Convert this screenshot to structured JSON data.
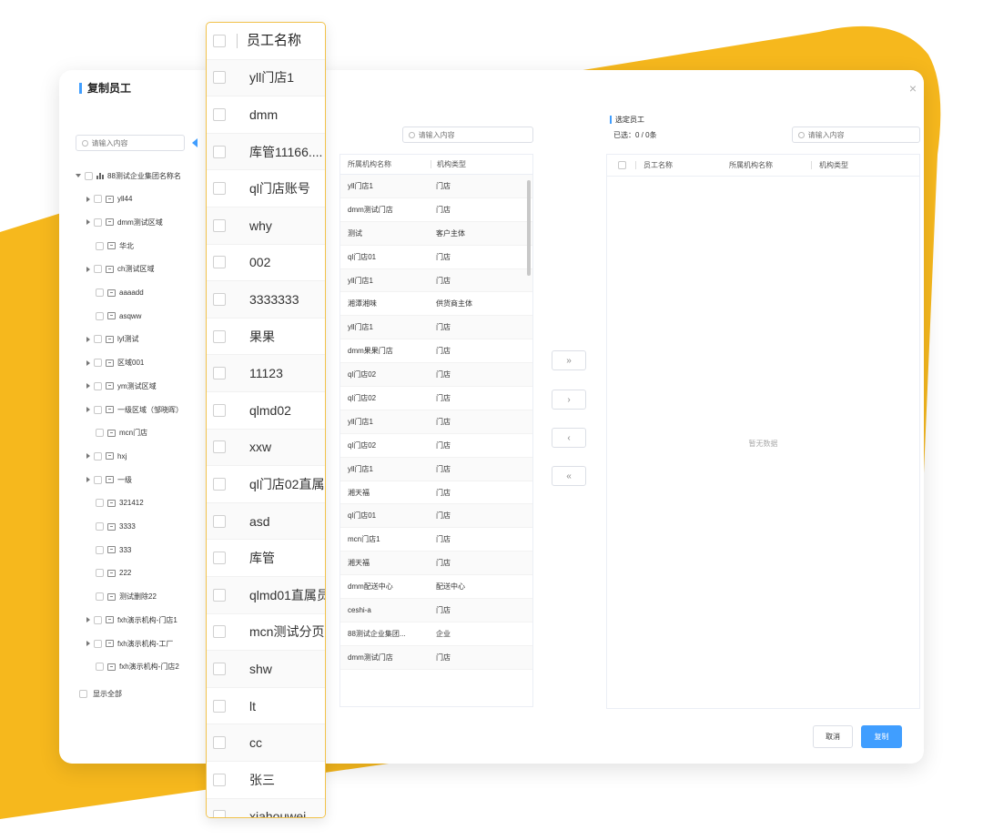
{
  "colors": {
    "accent": "#409eff",
    "yellow": "#f6b81d"
  },
  "dialog": {
    "title": "复制员工",
    "close_icon": "×",
    "left": {
      "search_placeholder": "请输入内容",
      "tree": [
        {
          "label": "88测试企业集团名称名",
          "depth": 0,
          "caret": "down",
          "icon": "bars"
        },
        {
          "label": "yll44",
          "depth": 1,
          "caret": "right"
        },
        {
          "label": "dmm测试区域",
          "depth": 1,
          "caret": "right"
        },
        {
          "label": "华北",
          "depth": 1,
          "caret": "none"
        },
        {
          "label": "ch测试区域",
          "depth": 1,
          "caret": "right"
        },
        {
          "label": "aaaadd",
          "depth": 1,
          "caret": "none"
        },
        {
          "label": "asqww",
          "depth": 1,
          "caret": "none"
        },
        {
          "label": "lyl测试",
          "depth": 1,
          "caret": "right"
        },
        {
          "label": "区域001",
          "depth": 1,
          "caret": "right"
        },
        {
          "label": "ym测试区域",
          "depth": 1,
          "caret": "right"
        },
        {
          "label": "一级区域（邹晓晖）",
          "depth": 1,
          "caret": "right"
        },
        {
          "label": "mcn门店",
          "depth": 1,
          "caret": "none"
        },
        {
          "label": "hxj",
          "depth": 1,
          "caret": "right"
        },
        {
          "label": "一级",
          "depth": 1,
          "caret": "right"
        },
        {
          "label": "321412",
          "depth": 1,
          "caret": "none"
        },
        {
          "label": "3333",
          "depth": 1,
          "caret": "none"
        },
        {
          "label": "333",
          "depth": 1,
          "caret": "none"
        },
        {
          "label": "222",
          "depth": 1,
          "caret": "none"
        },
        {
          "label": "测试删除22",
          "depth": 1,
          "caret": "none"
        },
        {
          "label": "fxh演示机构-门店1",
          "depth": 1,
          "caret": "right"
        },
        {
          "label": "fxh演示机构-工厂",
          "depth": 1,
          "caret": "right"
        },
        {
          "label": "fxh演示机构-门店2",
          "depth": 1,
          "caret": "none"
        }
      ],
      "show_all": "显示全部"
    },
    "middle": {
      "search_placeholder": "请输入内容",
      "columns": [
        "所属机构名称",
        "机构类型"
      ],
      "rows": [
        [
          "yll门店1",
          "门店"
        ],
        [
          "dmm测试门店",
          "门店"
        ],
        [
          "测试",
          "客户主体"
        ],
        [
          "ql门店01",
          "门店"
        ],
        [
          "yll门店1",
          "门店"
        ],
        [
          "湘潭湘味",
          "供货商主体"
        ],
        [
          "yll门店1",
          "门店"
        ],
        [
          "dmm果果门店",
          "门店"
        ],
        [
          "ql门店02",
          "门店"
        ],
        [
          "ql门店02",
          "门店"
        ],
        [
          "yll门店1",
          "门店"
        ],
        [
          "ql门店02",
          "门店"
        ],
        [
          "yll门店1",
          "门店"
        ],
        [
          "湘天福",
          "门店"
        ],
        [
          "ql门店01",
          "门店"
        ],
        [
          "mcn门店1",
          "门店"
        ],
        [
          "湘天福",
          "门店"
        ],
        [
          "dmm配送中心",
          "配送中心"
        ],
        [
          "ceshi-a",
          "门店"
        ],
        [
          "88测试企业集团...",
          "企业"
        ],
        [
          "dmm测试门店",
          "门店"
        ]
      ]
    },
    "transfer": {
      "all_right": "»",
      "right": "›",
      "left": "‹",
      "all_left": "«"
    },
    "right": {
      "title": "选定员工",
      "count": "已选：0 / 0条",
      "search_placeholder": "请输入内容",
      "columns": [
        "员工名称",
        "所属机构名称",
        "机构类型"
      ],
      "empty": "暂无数据"
    },
    "footer": {
      "cancel": "取消",
      "copy": "复制"
    }
  },
  "zoom": {
    "header": "员工名称",
    "names": [
      "yll门店1",
      "dmm",
      "库管11166....",
      "ql门店账号",
      "why",
      "002",
      "3333333",
      "果果",
      "11123",
      "qlmd02",
      "xxw",
      "ql门店02直属",
      "asd",
      "库管",
      "qlmd01直属员",
      "mcn测试分页",
      "shw",
      "lt",
      "cc",
      "张三",
      "xiahouwei"
    ]
  }
}
